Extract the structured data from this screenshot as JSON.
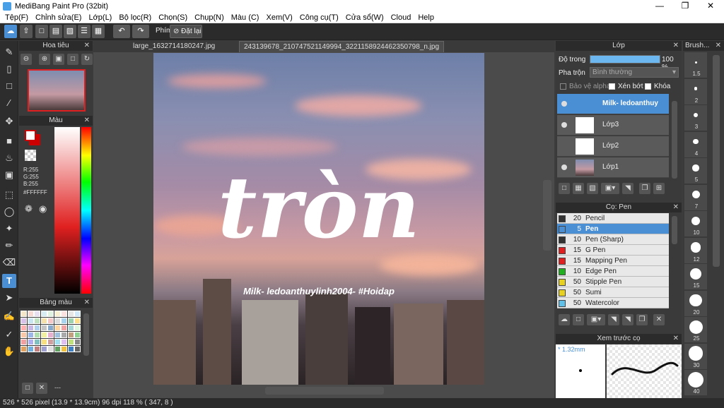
{
  "app": {
    "title": "MediBang Paint Pro (32bit)"
  },
  "menu": [
    "Tệp(F)",
    "Chỉnh sửa(E)",
    "Lớp(L)",
    "Bộ lọc(R)",
    "Chọn(S)",
    "Chụp(N)",
    "Màu (C)",
    "Xem(V)",
    "Công cụ(T)",
    "Cửa sổ(W)",
    "Cloud",
    "Help"
  ],
  "toolbar": {
    "shortcut_label": "Phím",
    "reset_label": "Đặt lại"
  },
  "tabs": [
    "large_1632714180247.jpg",
    "243139678_210747521149994_3221158924462350798_n.jpg"
  ],
  "navigator": {
    "title": "Hoa tiêu"
  },
  "color_panel": {
    "title": "Màu",
    "r": "R:255",
    "g": "G:255",
    "b": "B:255",
    "hex": "#FFFFFF",
    "primary": "#ffffff",
    "secondary": "#cc0000"
  },
  "palette": {
    "title": "Bảng màu",
    "footer": "---"
  },
  "canvas": {
    "artwork_main": "tròn",
    "artwork_caption": "Milk- ledoanthuylinh2004- #Hoidap"
  },
  "layers": {
    "title": "Lớp",
    "opacity_label": "Độ trong",
    "opacity_value": "100 %",
    "opacity": 1.0,
    "blend_label": "Pha trộn",
    "blend_value": "Bình thường",
    "protect_alpha": "Bảo vệ alpha",
    "clipping": "Xén bớt",
    "lock": "Khóa",
    "items": [
      {
        "name": "Milk- ledoanthuy",
        "selected": true
      },
      {
        "name": "Lớp3",
        "selected": false
      },
      {
        "name": "Lớp2",
        "selected": false
      },
      {
        "name": "Lớp1",
        "selected": false
      }
    ]
  },
  "brushes": {
    "title": "Cọ: Pen",
    "items": [
      {
        "size": "20",
        "name": "Pencil",
        "color": "#333333"
      },
      {
        "size": "5",
        "name": "Pen",
        "color": "#4a8fd4"
      },
      {
        "size": "10",
        "name": "Pen (Sharp)",
        "color": "#333333"
      },
      {
        "size": "15",
        "name": "G Pen",
        "color": "#e02020"
      },
      {
        "size": "15",
        "name": "Mapping Pen",
        "color": "#e02020"
      },
      {
        "size": "10",
        "name": "Edge Pen",
        "color": "#20b020"
      },
      {
        "size": "50",
        "name": "Stipple Pen",
        "color": "#e8d020"
      },
      {
        "size": "50",
        "name": "Sumi",
        "color": "#e8d020"
      },
      {
        "size": "50",
        "name": "Watercolor",
        "color": "#60c0e8"
      }
    ]
  },
  "preview": {
    "title": "Xem trước cọ",
    "size": "* 1.32mm"
  },
  "brush_size": {
    "title": "Brush...",
    "sizes": [
      "1.5",
      "2",
      "3",
      "4",
      "5",
      "7",
      "10",
      "12",
      "15",
      "20",
      "25",
      "30",
      "40"
    ]
  },
  "status": {
    "text": "526 * 526 pixel   (13.9 * 13.9cm)   96 dpi   118 %   ( 347, 8 )"
  }
}
